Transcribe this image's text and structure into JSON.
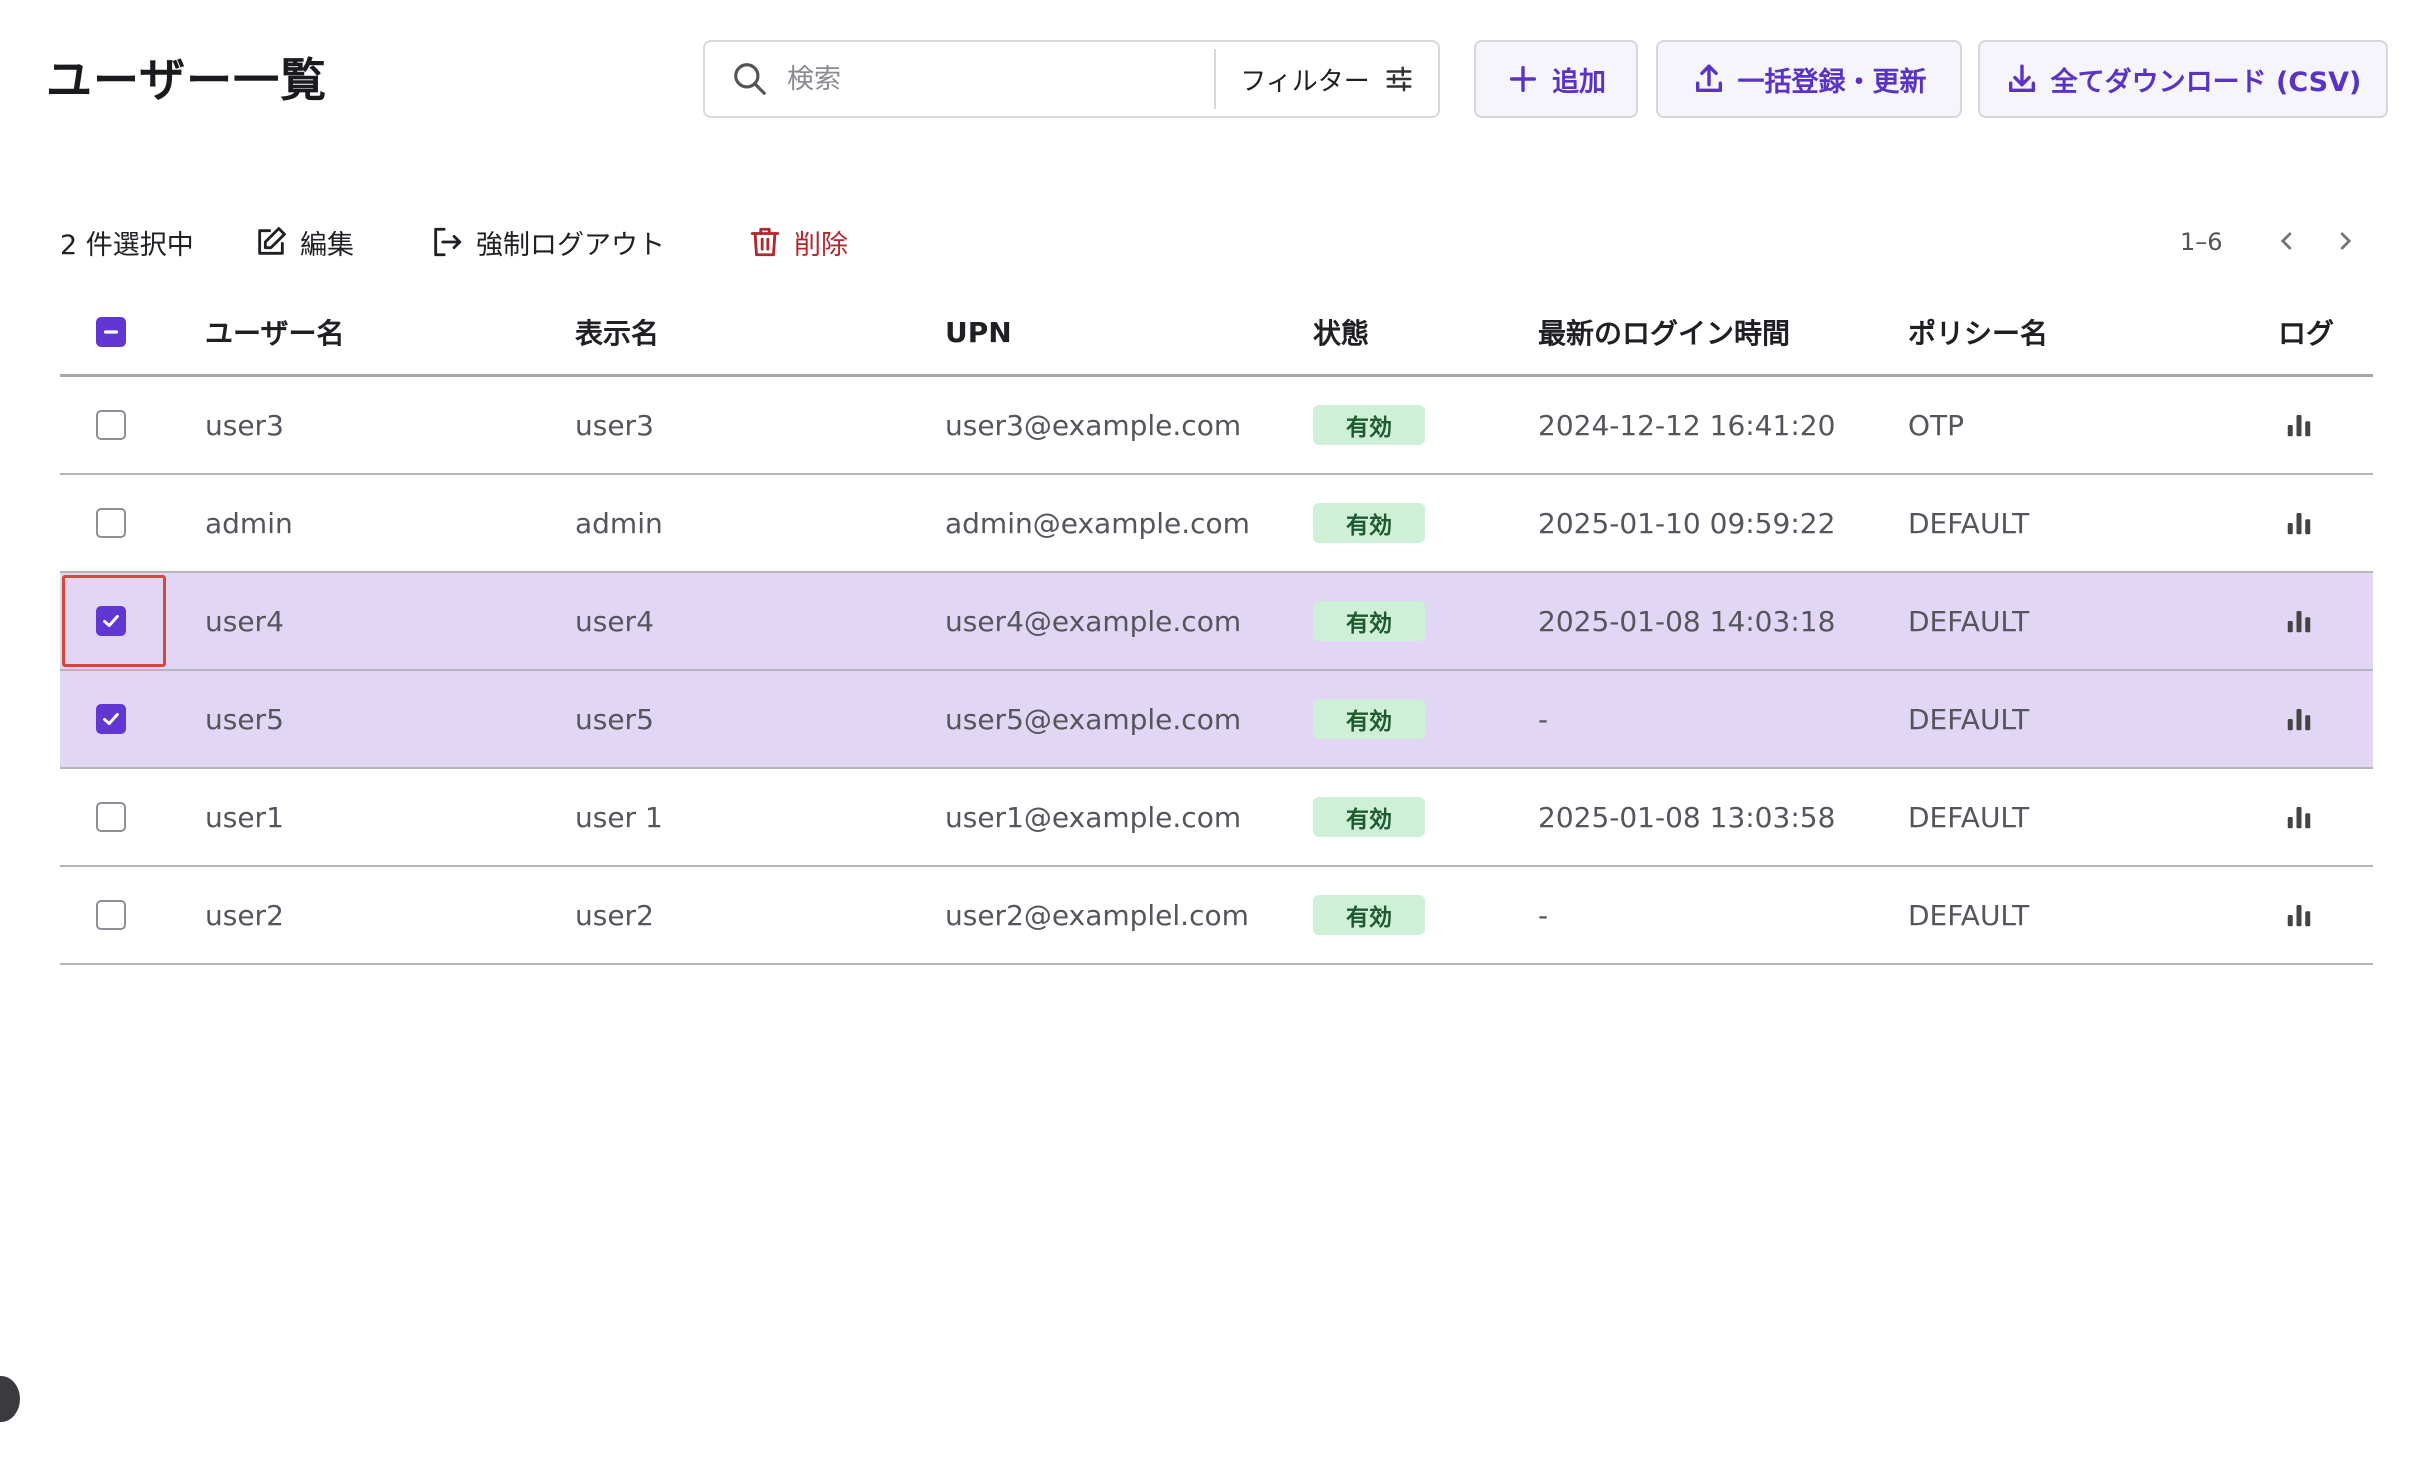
{
  "page": {
    "title": "ユーザー一覧"
  },
  "search": {
    "placeholder": "検索",
    "filter_label": "フィルター"
  },
  "actions": {
    "add_label": "追加",
    "bulk_label": "一括登録・更新",
    "download_label": "全てダウンロード (CSV)"
  },
  "selection": {
    "count_label": "2 件選択中",
    "edit_label": "編集",
    "logout_label": "強制ログアウト",
    "delete_label": "削除"
  },
  "pagination": {
    "range": "1–6"
  },
  "table": {
    "columns": {
      "username": "ユーザー名",
      "display_name": "表示名",
      "upn": "UPN",
      "status": "状態",
      "last_login": "最新のログイン時間",
      "policy": "ポリシー名",
      "log": "ログ"
    },
    "rows": [
      {
        "username": "user3",
        "display_name": "user3",
        "upn": "user3@example.com",
        "status": "有効",
        "last_login": "2024-12-12 16:41:20",
        "policy": "OTP",
        "selected": false
      },
      {
        "username": "admin",
        "display_name": "admin",
        "upn": "admin@example.com",
        "status": "有効",
        "last_login": "2025-01-10 09:59:22",
        "policy": "DEFAULT",
        "selected": false
      },
      {
        "username": "user4",
        "display_name": "user4",
        "upn": "user4@example.com",
        "status": "有効",
        "last_login": "2025-01-08 14:03:18",
        "policy": "DEFAULT",
        "selected": true
      },
      {
        "username": "user5",
        "display_name": "user5",
        "upn": "user5@example.com",
        "status": "有効",
        "last_login": "-",
        "policy": "DEFAULT",
        "selected": true
      },
      {
        "username": "user1",
        "display_name": "user 1",
        "upn": "user1@example.com",
        "status": "有効",
        "last_login": "2025-01-08 13:03:58",
        "policy": "DEFAULT",
        "selected": false
      },
      {
        "username": "user2",
        "display_name": "user2",
        "upn": "user2@examplel.com",
        "status": "有効",
        "last_login": "-",
        "policy": "DEFAULT",
        "selected": false
      }
    ]
  },
  "colors": {
    "accent": "#6236d3",
    "selected_row": "#e1d7f5",
    "status_badge_bg": "#cdf0d6",
    "danger": "#b3262e",
    "focus_ring": "#d4493b"
  },
  "icons": [
    "search-icon",
    "filter-sliders-icon",
    "plus-icon",
    "upload-icon",
    "download-icon",
    "edit-icon",
    "logout-icon",
    "trash-icon",
    "chevron-left-icon",
    "chevron-right-icon",
    "bar-chart-icon"
  ]
}
